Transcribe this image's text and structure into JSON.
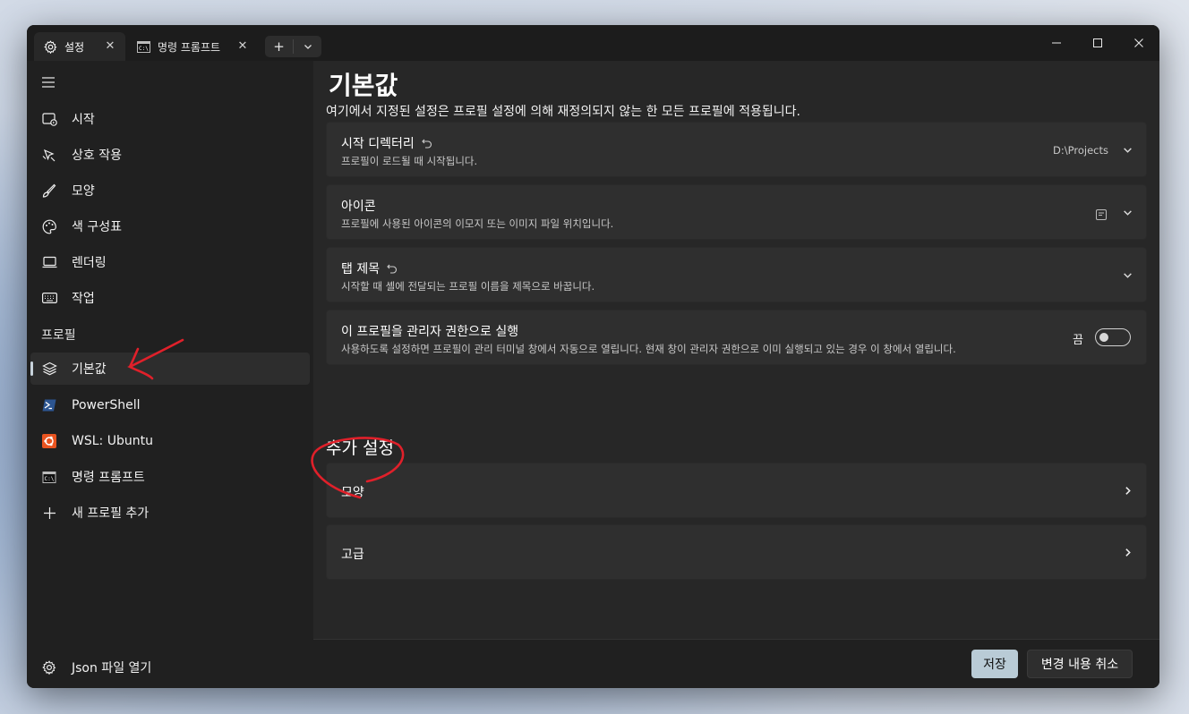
{
  "tabs": [
    {
      "label": "설정",
      "icon": "gear-icon",
      "close": "✕"
    },
    {
      "label": "명령 프롬프트",
      "icon": "cmd-icon",
      "close": "✕"
    }
  ],
  "tabbar": {
    "new_tab": "+",
    "dropdown": "⌄"
  },
  "sidebar": {
    "items": [
      {
        "label": "시작",
        "icon": "startup-icon"
      },
      {
        "label": "상호 작용",
        "icon": "interaction-icon"
      },
      {
        "label": "모양",
        "icon": "brush-icon"
      },
      {
        "label": "색 구성표",
        "icon": "palette-icon"
      },
      {
        "label": "렌더링",
        "icon": "monitor-icon"
      },
      {
        "label": "작업",
        "icon": "keyboard-icon"
      }
    ],
    "profiles_header": "프로필",
    "profiles": [
      {
        "label": "기본값",
        "icon": "layers-icon",
        "selected": true
      },
      {
        "label": "PowerShell",
        "icon": "powershell-icon"
      },
      {
        "label": "WSL: Ubuntu",
        "icon": "ubuntu-icon"
      },
      {
        "label": "명령 프롬프트",
        "icon": "cmd-icon"
      },
      {
        "label": "새 프로필 추가",
        "icon": "plus-icon"
      }
    ],
    "open_json": "Json 파일 열기"
  },
  "main": {
    "title": "기본값",
    "description": "여기에서 지정된 설정은 프로필 설정에 의해 재정의되지 않는 한 모든 프로필에 적용됩니다.",
    "settings": [
      {
        "title": "시작 디렉터리",
        "subtitle": "프로필이 로드될 때 시작됩니다.",
        "value": "D:\\Projects",
        "reset": true
      },
      {
        "title": "아이콘",
        "subtitle": "프로필에 사용된 아이콘의 이모지 또는 이미지 파일 위치입니다.",
        "value": "",
        "reset": false
      },
      {
        "title": "탭 제목",
        "subtitle": "시작할 때 셸에 전달되는 프로필 이름을 제목으로 바꿉니다.",
        "value": "",
        "reset": true
      },
      {
        "title": "이 프로필을 관리자 권한으로 실행",
        "subtitle": "사용하도록 설정하면 프로필이 관리 터미널 창에서 자동으로 열립니다. 현재 창이 관리자 권한으로 이미 실행되고 있는 경우 이 창에서 열립니다.",
        "toggle_label": "끔",
        "toggle_on": false
      }
    ],
    "additional_title": "추가 설정",
    "additional": [
      {
        "label": "모양"
      },
      {
        "label": "고급"
      }
    ]
  },
  "footer": {
    "save": "저장",
    "discard": "변경 내용 취소"
  },
  "colors": {
    "accent": "#b9cbd6",
    "annotation": "#e0202a"
  }
}
